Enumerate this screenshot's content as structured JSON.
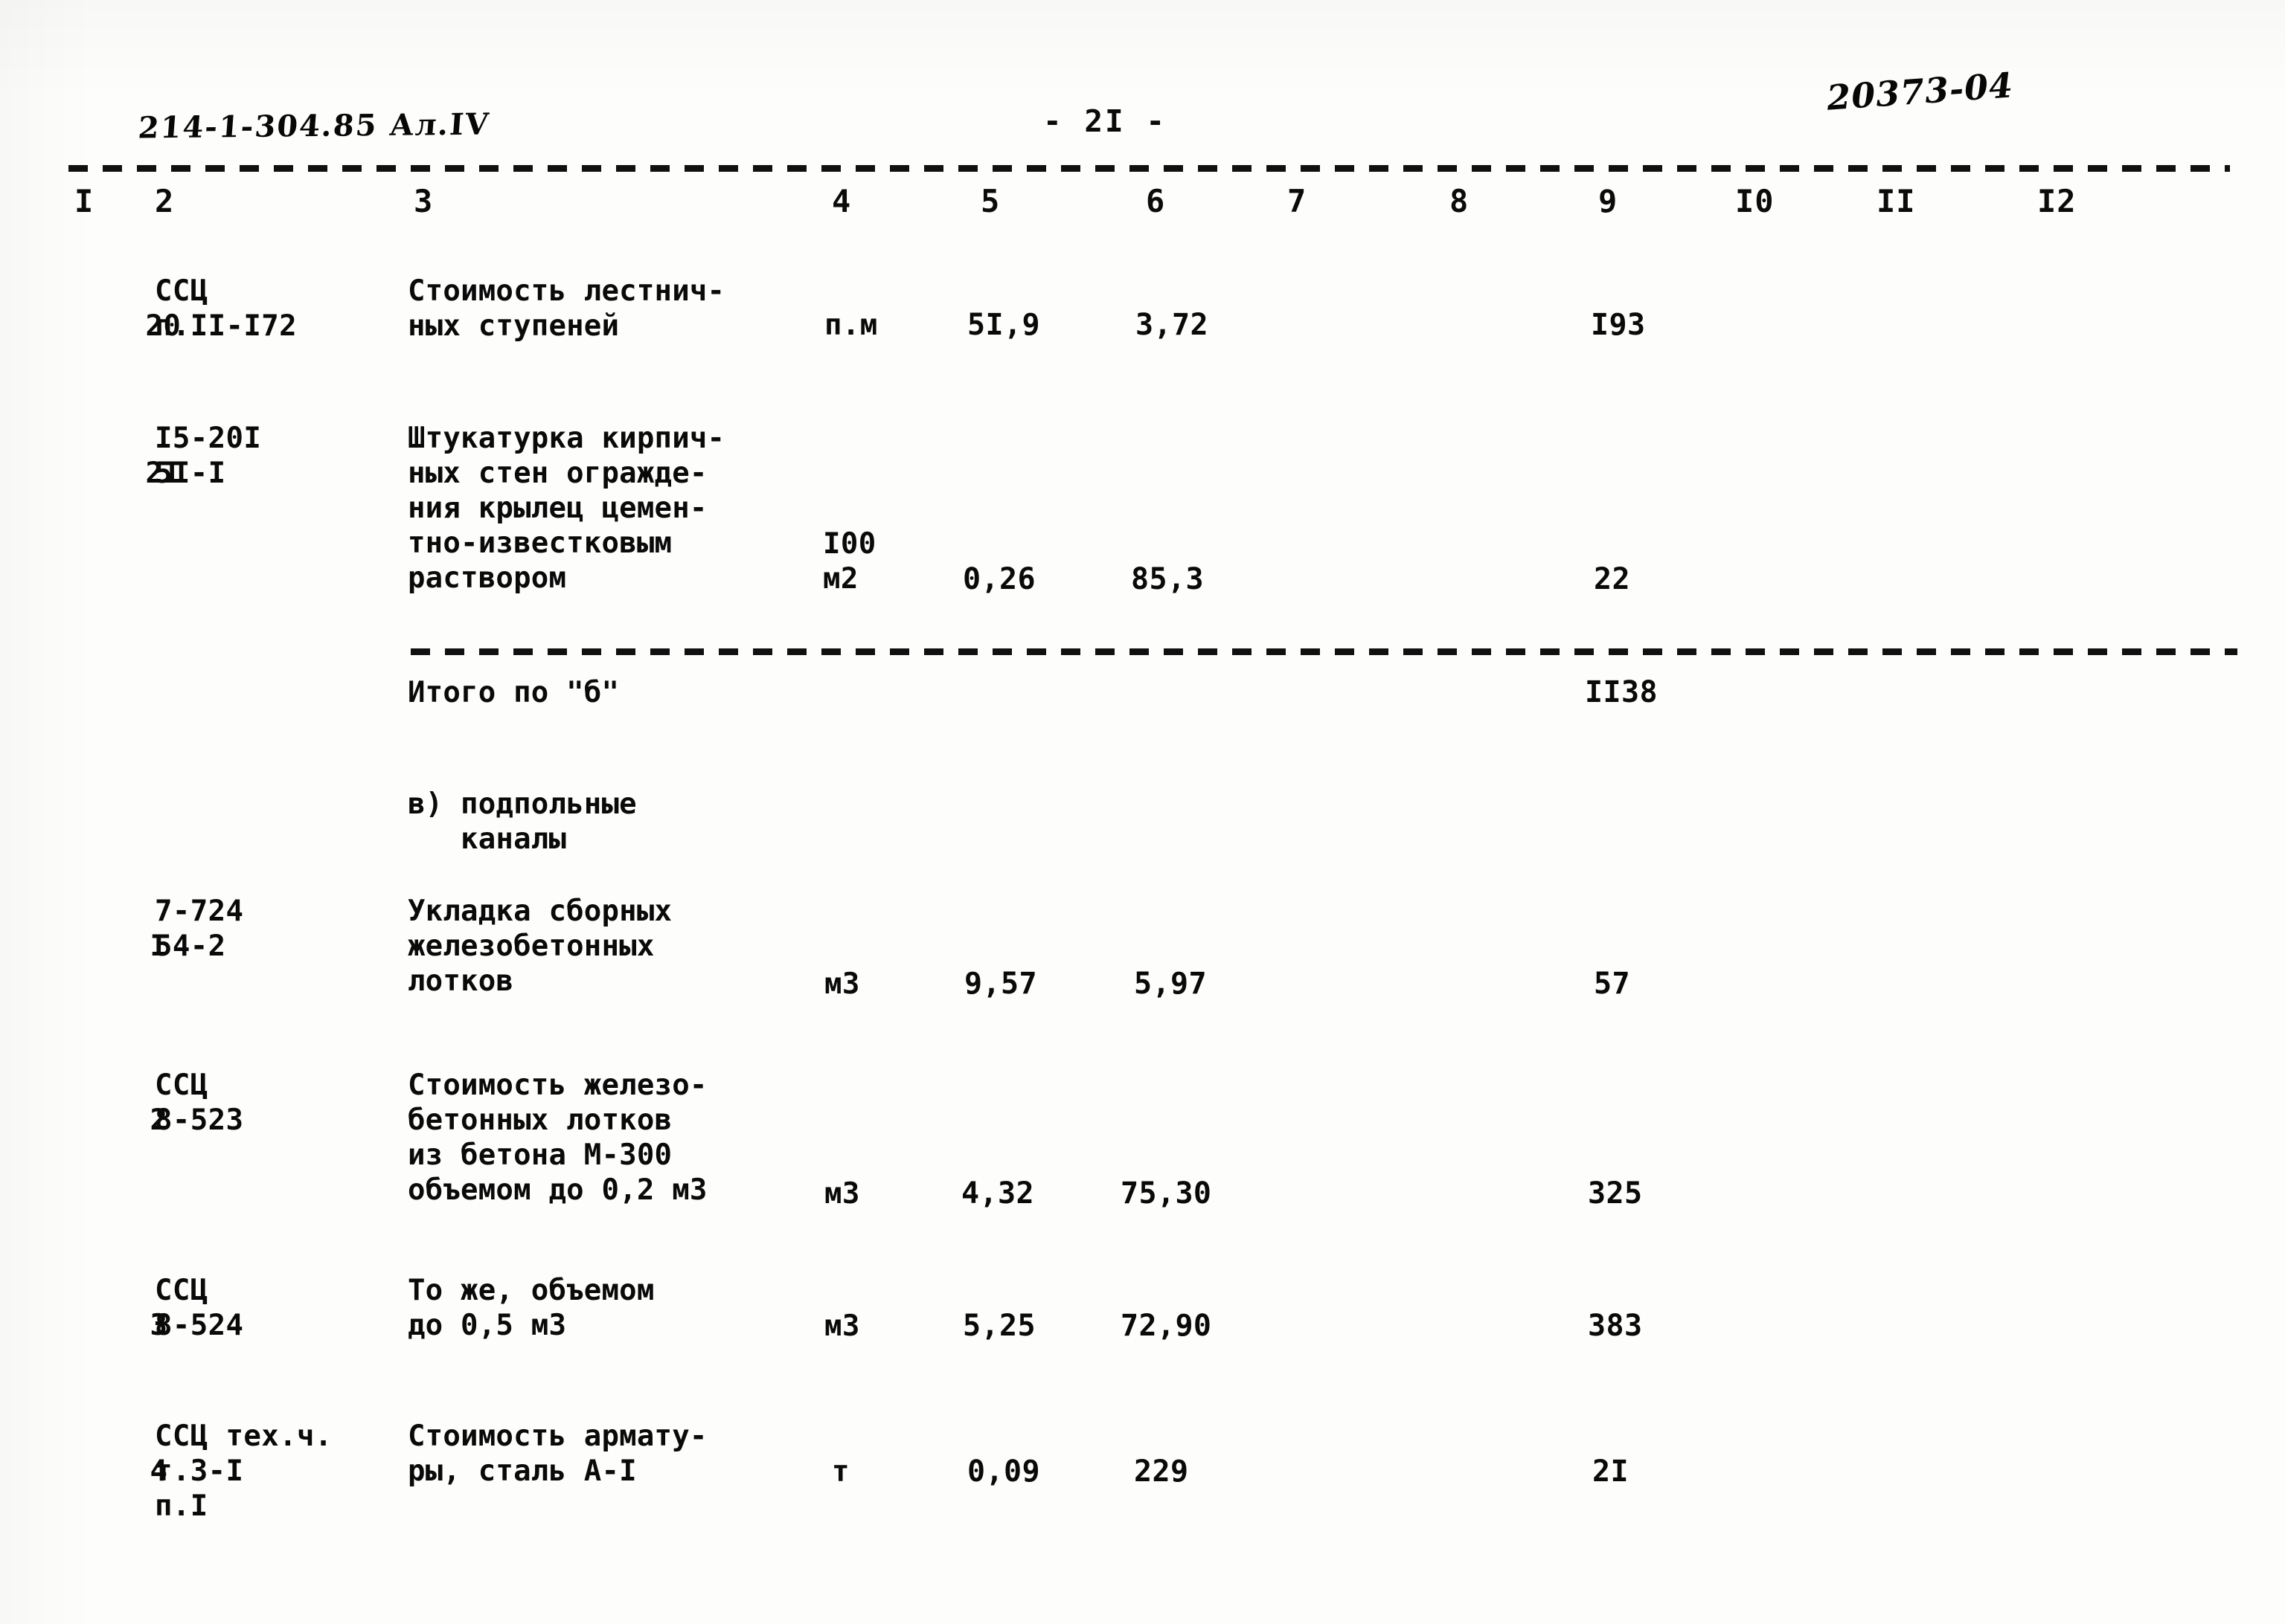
{
  "document": {
    "handwritten_code": "214-1-304.85  Ал.IV",
    "page_label": "- 2I -",
    "archive_stamp": "20373-04"
  },
  "table": {
    "column_headers": [
      "I",
      "2",
      "3",
      "4",
      "5",
      "6",
      "7",
      "8",
      "9",
      "I0",
      "II",
      "I2"
    ],
    "rows": [
      {
        "no": "20",
        "code": "ССЦ\nп.II-I72",
        "description": "Стоимость лестнич-\nных ступеней",
        "unit": "п.м",
        "qty": "5I,9",
        "price": "3,72",
        "total": "I93"
      },
      {
        "no": "2I",
        "code": "I5-20I\n5I-I",
        "description": "Штукатурка кирпич-\nных стен огражде-\nния крылец цемен-\nтно-известковым\nраствором",
        "unit": "I00\nм2",
        "qty": "0,26",
        "price": "85,3",
        "total": "22"
      }
    ],
    "subtotal": {
      "label": "Итого по \"б\"",
      "value": "II38"
    },
    "section_heading": "в) подпольные\n   каналы",
    "rows2": [
      {
        "no": "I",
        "code": "7-724\n54-2",
        "description": "Укладка сборных\nжелезобетонных\nлотков",
        "unit": "м3",
        "qty": "9,57",
        "price": "5,97",
        "total": "57"
      },
      {
        "no": "2",
        "code": "ССЦ\n8-523",
        "description": "Стоимость железо-\nбетонных лотков\nиз бетона М-300\nобъемом до 0,2 м3",
        "unit": "м3",
        "qty": "4,32",
        "price": "75,30",
        "total": "325"
      },
      {
        "no": "3",
        "code": "ССЦ\n8-524",
        "description": "То же, объемом\nдо 0,5 м3",
        "unit": "м3",
        "qty": "5,25",
        "price": "72,90",
        "total": "383"
      },
      {
        "no": "4",
        "code": "ССЦ тех.ч.\nт.3-I\nп.I",
        "description": "Стоимость армату-\nры, сталь А-I",
        "unit": "т",
        "qty": "0,09",
        "price": "229",
        "total": "2I"
      }
    ]
  }
}
